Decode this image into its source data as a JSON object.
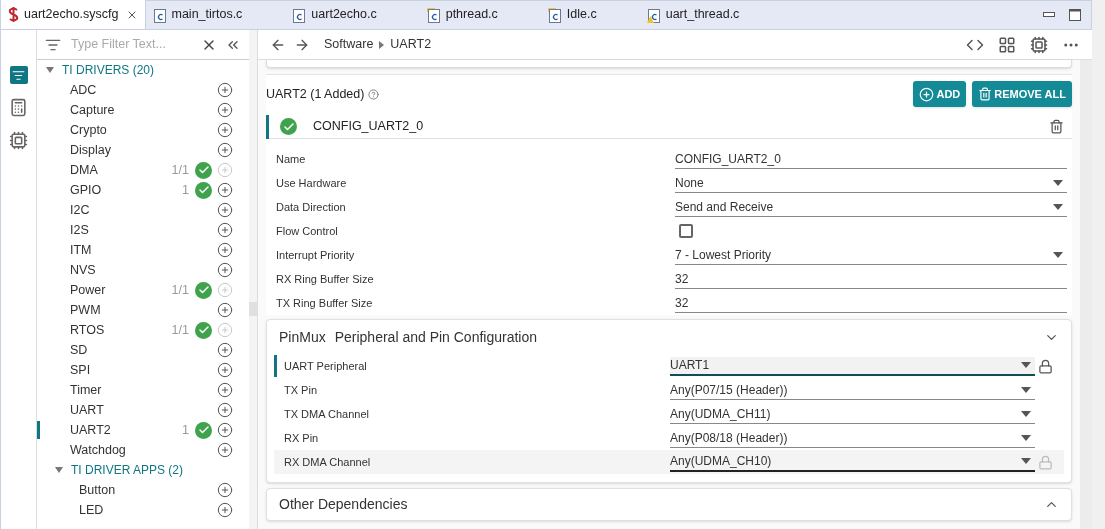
{
  "tabs": [
    {
      "label": "uart2echo.syscfg",
      "kind": "syscfg",
      "selected": true,
      "closable": true
    },
    {
      "label": "main_tirtos.c",
      "kind": "c",
      "selected": false,
      "closable": false
    },
    {
      "label": "uart2echo.c",
      "kind": "c",
      "selected": false,
      "closable": false
    },
    {
      "label": "pthread.c",
      "kind": "c-folder",
      "selected": false,
      "closable": false
    },
    {
      "label": "Idle.c",
      "kind": "c-folder",
      "selected": false,
      "closable": false
    },
    {
      "label": "uart_thread.c",
      "kind": "c-warning",
      "selected": false,
      "closable": false
    }
  ],
  "sidebar": {
    "filter": {
      "placeholder": "Type Filter Text..."
    },
    "groups": [
      {
        "title": "TI DRIVERS (20)",
        "expanded": true,
        "items": [
          {
            "label": "ADC",
            "selected": false,
            "add_disabled": false
          },
          {
            "label": "Capture",
            "selected": false,
            "add_disabled": false
          },
          {
            "label": "Crypto",
            "selected": false,
            "add_disabled": false
          },
          {
            "label": "Display",
            "selected": false,
            "add_disabled": false
          },
          {
            "label": "DMA",
            "count": "1/1",
            "added": true,
            "selected": false,
            "add_disabled": true
          },
          {
            "label": "GPIO",
            "count": "1",
            "added": true,
            "selected": false,
            "add_disabled": false
          },
          {
            "label": "I2C",
            "selected": false,
            "add_disabled": false
          },
          {
            "label": "I2S",
            "selected": false,
            "add_disabled": false
          },
          {
            "label": "ITM",
            "selected": false,
            "add_disabled": false
          },
          {
            "label": "NVS",
            "selected": false,
            "add_disabled": false
          },
          {
            "label": "Power",
            "count": "1/1",
            "added": true,
            "selected": false,
            "add_disabled": true
          },
          {
            "label": "PWM",
            "selected": false,
            "add_disabled": false
          },
          {
            "label": "RTOS",
            "count": "1/1",
            "added": true,
            "selected": false,
            "add_disabled": true
          },
          {
            "label": "SD",
            "selected": false,
            "add_disabled": false
          },
          {
            "label": "SPI",
            "selected": false,
            "add_disabled": false
          },
          {
            "label": "Timer",
            "selected": false,
            "add_disabled": false
          },
          {
            "label": "UART",
            "selected": false,
            "add_disabled": false
          },
          {
            "label": "UART2",
            "count": "1",
            "added": true,
            "selected": true,
            "add_disabled": false
          },
          {
            "label": "Watchdog",
            "selected": false,
            "add_disabled": false
          }
        ]
      },
      {
        "title": "TI DRIVER APPS (2)",
        "expanded": true,
        "items": [
          {
            "label": "Button",
            "selected": false,
            "add_disabled": false
          },
          {
            "label": "LED",
            "selected": false,
            "add_disabled": false
          }
        ]
      }
    ]
  },
  "breadcrumb": [
    "Software",
    "UART2"
  ],
  "module": {
    "title": "UART2 (1 Added)",
    "buttons": [
      {
        "label": "ADD",
        "kind": "add"
      },
      {
        "label": "REMOVE ALL",
        "kind": "remove"
      }
    ],
    "instance": {
      "name": "CONFIG_UART2_0",
      "ok": true
    },
    "fields": [
      {
        "label": "Name",
        "kind": "text",
        "value": "CONFIG_UART2_0"
      },
      {
        "label": "Use Hardware",
        "kind": "select",
        "value": "None"
      },
      {
        "label": "Data Direction",
        "kind": "select",
        "value": "Send and Receive"
      },
      {
        "label": "Flow Control",
        "kind": "checkbox",
        "checked": false
      },
      {
        "label": "Interrupt Priority",
        "kind": "select",
        "value": "7 - Lowest Priority"
      },
      {
        "label": "RX Ring Buffer Size",
        "kind": "text",
        "value": "32"
      },
      {
        "label": "TX Ring Buffer Size",
        "kind": "text",
        "value": "32"
      }
    ]
  },
  "pinmux": {
    "title": "PinMux",
    "subtitle": "Peripheral and Pin Configuration",
    "expanded": true,
    "fields": [
      {
        "label": "UART Peripheral",
        "value": "UART1",
        "focused": true,
        "hovered": false,
        "lock_enabled": true
      },
      {
        "label": "TX Pin",
        "value": "Any(P07/15 (Header))",
        "focused": false,
        "hovered": false
      },
      {
        "label": "TX DMA Channel",
        "value": "Any(UDMA_CH11)",
        "focused": false,
        "hovered": false
      },
      {
        "label": "RX Pin",
        "value": "Any(P08/18 (Header))",
        "focused": false,
        "hovered": false
      },
      {
        "label": "RX DMA Channel",
        "value": "Any(UDMA_CH10)",
        "focused": false,
        "hovered": true,
        "lock_enabled": false
      }
    ]
  },
  "dependencies": {
    "title": "Other Dependencies",
    "expanded": false
  }
}
